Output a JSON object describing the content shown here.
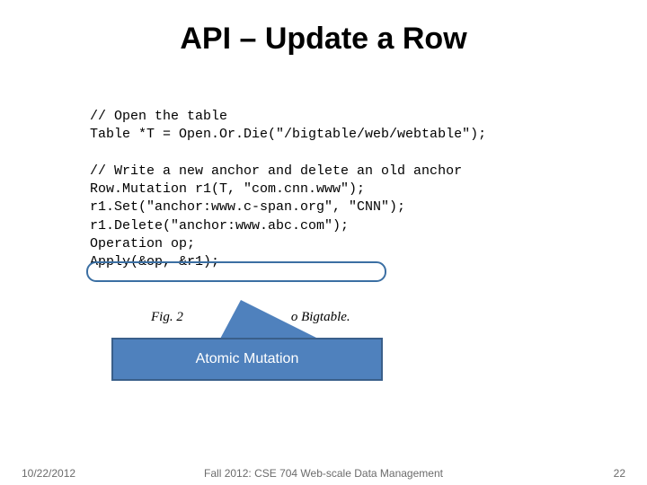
{
  "title": "API – Update a Row",
  "code": {
    "line1": "// Open the table",
    "line2": "Table *T = Open.Or.Die(\"/bigtable/web/webtable\");",
    "line3": "",
    "line4": "// Write a new anchor and delete an old anchor",
    "line5": "Row.Mutation r1(T, \"com.cnn.www\");",
    "line6": "r1.Set(\"anchor:www.c-span.org\", \"CNN\");",
    "line7": "r1.Delete(\"anchor:www.abc.com\");",
    "line8": "Operation op;",
    "line9": "Apply(&op, &r1);"
  },
  "fig_caption_left": "Fig. 2",
  "fig_caption_right": "o Bigtable.",
  "callout": "Atomic Mutation",
  "footer": {
    "date": "10/22/2012",
    "center": "Fall 2012: CSE 704 Web-scale Data Management",
    "page": "22"
  },
  "colors": {
    "accent": "#4f81bd",
    "accent_border": "#3a5f8a",
    "highlight_border": "#3b6fa3"
  }
}
